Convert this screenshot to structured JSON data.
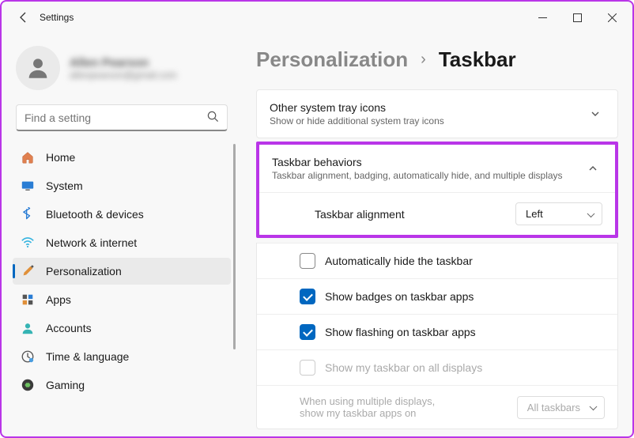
{
  "window": {
    "title": "Settings"
  },
  "user": {
    "name": "Allen Pearson",
    "email": "allenpearson@gmail.com"
  },
  "search": {
    "placeholder": "Find a setting"
  },
  "nav": [
    {
      "key": "home",
      "label": "Home"
    },
    {
      "key": "system",
      "label": "System"
    },
    {
      "key": "bluetooth",
      "label": "Bluetooth & devices"
    },
    {
      "key": "network",
      "label": "Network & internet"
    },
    {
      "key": "personalization",
      "label": "Personalization",
      "active": true
    },
    {
      "key": "apps",
      "label": "Apps"
    },
    {
      "key": "accounts",
      "label": "Accounts"
    },
    {
      "key": "time",
      "label": "Time & language"
    },
    {
      "key": "gaming",
      "label": "Gaming"
    }
  ],
  "breadcrumb": {
    "parent": "Personalization",
    "current": "Taskbar"
  },
  "tray": {
    "title": "Other system tray icons",
    "sub": "Show or hide additional system tray icons"
  },
  "behaviors": {
    "title": "Taskbar behaviors",
    "sub": "Taskbar alignment, badging, automatically hide, and multiple displays",
    "alignment_label": "Taskbar alignment",
    "alignment_value": "Left",
    "auto_hide": "Automatically hide the taskbar",
    "badges": "Show badges on taskbar apps",
    "flashing": "Show flashing on taskbar apps",
    "all_displays": "Show my taskbar on all displays",
    "multi_line1": "When using multiple displays,",
    "multi_line2": "show my taskbar apps on",
    "multi_value": "All taskbars"
  }
}
